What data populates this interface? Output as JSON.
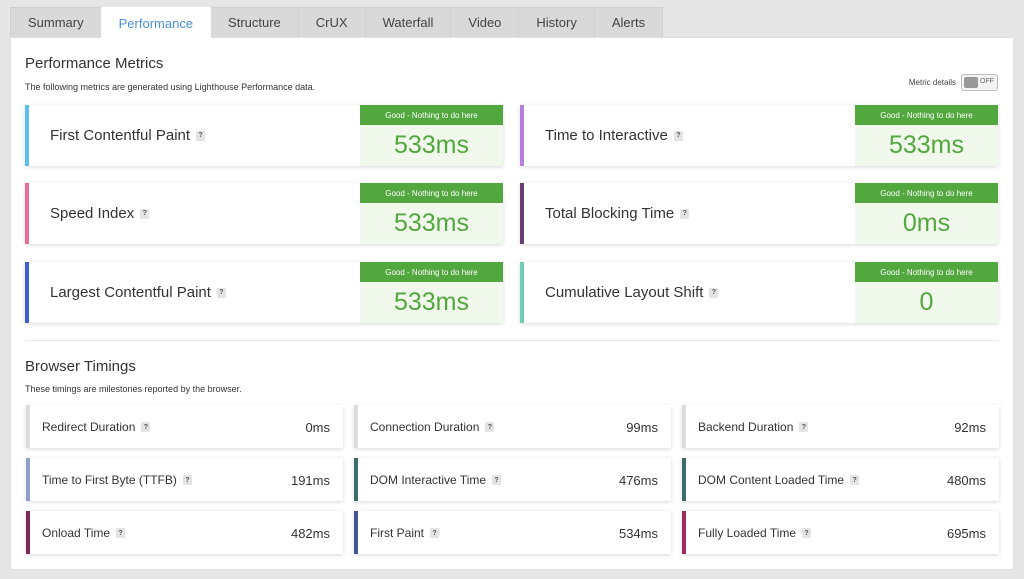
{
  "tabs": [
    "Summary",
    "Performance",
    "Structure",
    "CrUX",
    "Waterfall",
    "Video",
    "History",
    "Alerts"
  ],
  "performance": {
    "title": "Performance Metrics",
    "subtitle": "The following metrics are generated using Lighthouse Performance data.",
    "toggle_label": "Metric details",
    "toggle_state": "OFF",
    "help_glyph": "?",
    "metrics": [
      {
        "name": "First Contentful Paint",
        "grade": "Good - Nothing to do here",
        "value": "533ms",
        "accent": "#5bc0eb"
      },
      {
        "name": "Time to Interactive",
        "grade": "Good - Nothing to do here",
        "value": "533ms",
        "accent": "#b57edc"
      },
      {
        "name": "Speed Index",
        "grade": "Good - Nothing to do here",
        "value": "533ms",
        "accent": "#e36e9a"
      },
      {
        "name": "Total Blocking Time",
        "grade": "Good - Nothing to do here",
        "value": "0ms",
        "accent": "#6b3e75"
      },
      {
        "name": "Largest Contentful Paint",
        "grade": "Good - Nothing to do here",
        "value": "533ms",
        "accent": "#3f5fcc"
      },
      {
        "name": "Cumulative Layout Shift",
        "grade": "Good - Nothing to do here",
        "value": "0",
        "accent": "#6fcfb6"
      }
    ],
    "grade_color": "#52a73e"
  },
  "browser": {
    "title": "Browser Timings",
    "subtitle": "These timings are milestones reported by the browser.",
    "timings": [
      {
        "name": "Redirect Duration",
        "value": "0ms",
        "accent": "#dcdcdc"
      },
      {
        "name": "Connection Duration",
        "value": "99ms",
        "accent": "#dcdcdc"
      },
      {
        "name": "Backend Duration",
        "value": "92ms",
        "accent": "#dcdcdc"
      },
      {
        "name": "Time to First Byte (TTFB)",
        "value": "191ms",
        "accent": "#8f9fc9"
      },
      {
        "name": "DOM Interactive Time",
        "value": "476ms",
        "accent": "#3d6b6b"
      },
      {
        "name": "DOM Content Loaded Time",
        "value": "480ms",
        "accent": "#3d6b6b"
      },
      {
        "name": "Onload Time",
        "value": "482ms",
        "accent": "#7a2a55"
      },
      {
        "name": "First Paint",
        "value": "534ms",
        "accent": "#3f5596"
      },
      {
        "name": "Fully Loaded Time",
        "value": "695ms",
        "accent": "#9c2a5a"
      }
    ]
  }
}
